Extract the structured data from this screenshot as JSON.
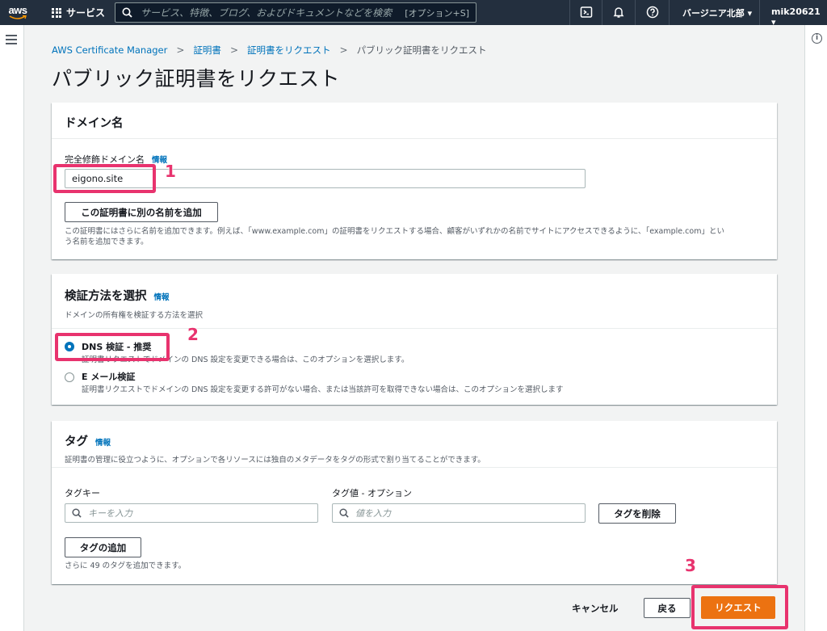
{
  "topnav": {
    "logo_text": "aws",
    "services_label": "サービス",
    "search_placeholder": "サービス、特徴、ブログ、およびドキュメントなどを検索",
    "search_hint": "[オプション+S]",
    "region_label": "バージニア北部 ▾",
    "account_label": "mik20621 ▾"
  },
  "breadcrumb": {
    "items": [
      "AWS Certificate Manager",
      "証明書",
      "証明書をリクエスト"
    ],
    "current": "パブリック証明書をリクエスト"
  },
  "page_title": "パブリック証明書をリクエスト",
  "domain_panel": {
    "title": "ドメイン名",
    "field_label": "完全修飾ドメイン名",
    "info": "情報",
    "domain_value": "eigono.site",
    "add_name_button": "この証明書に別の名前を追加",
    "help_line1": "この証明書にはさらに名前を追加できます。例えば、「www.example.com」の証明書をリクエストする場合、顧客がいずれかの名前でサイトにアクセスできるように、「example.com」とい",
    "help_line2": "う名前を追加できます。"
  },
  "validation_panel": {
    "title": "検証方法を選択",
    "info": "情報",
    "description": "ドメインの所有権を検証する方法を選択",
    "options": [
      {
        "label": "DNS 検証 - 推奨",
        "desc": "証明書リクエストでドメインの DNS 設定を変更できる場合は、このオプションを選択します。",
        "checked": true
      },
      {
        "label": "E メール検証",
        "desc": "証明書リクエストでドメインの DNS 設定を変更する許可がない場合、または当該許可を取得できない場合は、このオプションを選択します",
        "checked": false
      }
    ]
  },
  "tag_panel": {
    "title": "タグ",
    "info": "情報",
    "description": "証明書の管理に役立つように、オプションで各リソースには独自のメタデータをタグの形式で割り当てることができます。",
    "key_label": "タグキー",
    "value_label": "タグ値 - オプション",
    "key_placeholder": "キーを入力",
    "value_placeholder": "値を入力",
    "remove_button": "タグを削除",
    "add_button": "タグの追加",
    "remaining_text": "さらに 49 のタグを追加できます。"
  },
  "footer": {
    "cancel": "キャンセル",
    "back": "戻る",
    "submit": "リクエスト"
  },
  "annotations": [
    "1",
    "2",
    "3"
  ],
  "colors": {
    "nav_bg": "#232f3e",
    "link": "#0073bb",
    "primary": "#ec7211",
    "annotation": "#e8336e"
  }
}
